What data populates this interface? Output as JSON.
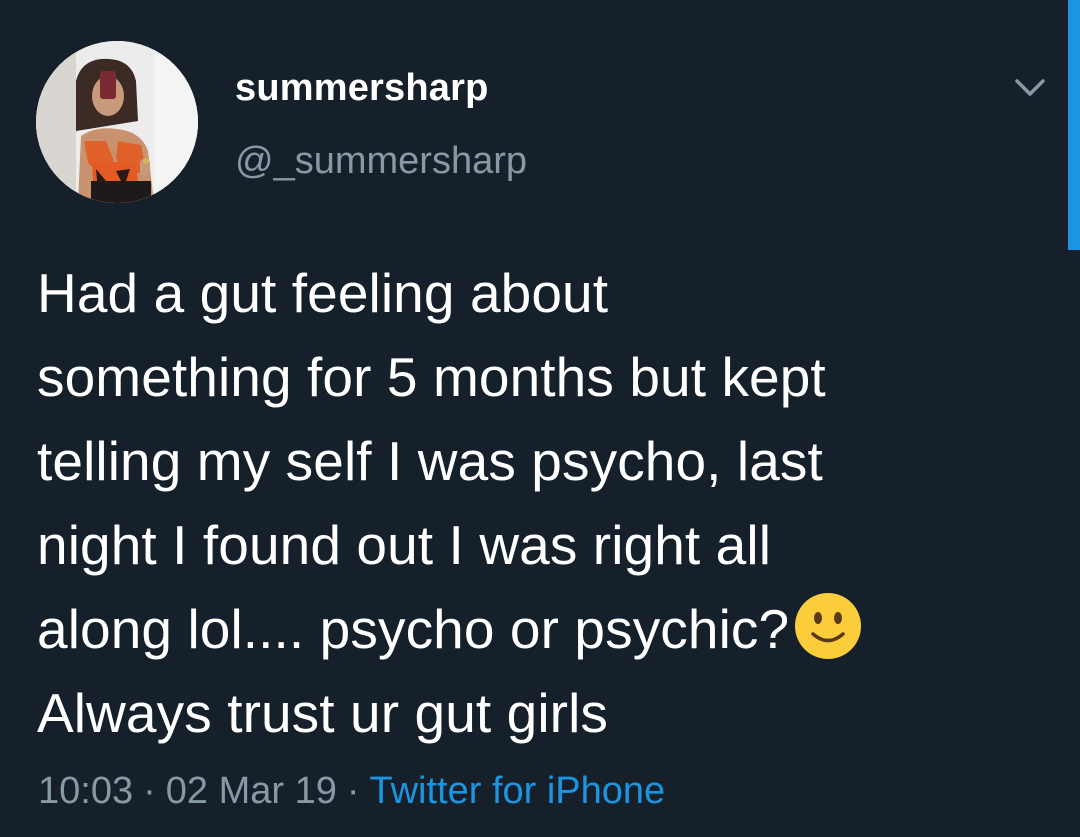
{
  "user": {
    "display_name": "summersharp",
    "handle": "@_summersharp"
  },
  "tweet": {
    "lines": [
      "Had a gut feeling about",
      "something for 5 months but kept",
      "telling my self I was psycho, last",
      "night I found out I was right all",
      "along lol.... psycho or psychic?",
      "Always trust ur gut girls"
    ],
    "emoji": "slightly-smiling-face"
  },
  "meta": {
    "time": "10:03",
    "separator": "·",
    "date": "02 Mar 19",
    "source": "Twitter for iPhone"
  },
  "icons": {
    "menu": "chevron-down-icon"
  },
  "colors": {
    "background": "#15202b",
    "text": "#ffffff",
    "secondary": "#8899a6",
    "accent": "#1b95e0",
    "emoji": "#fbcd3b"
  }
}
